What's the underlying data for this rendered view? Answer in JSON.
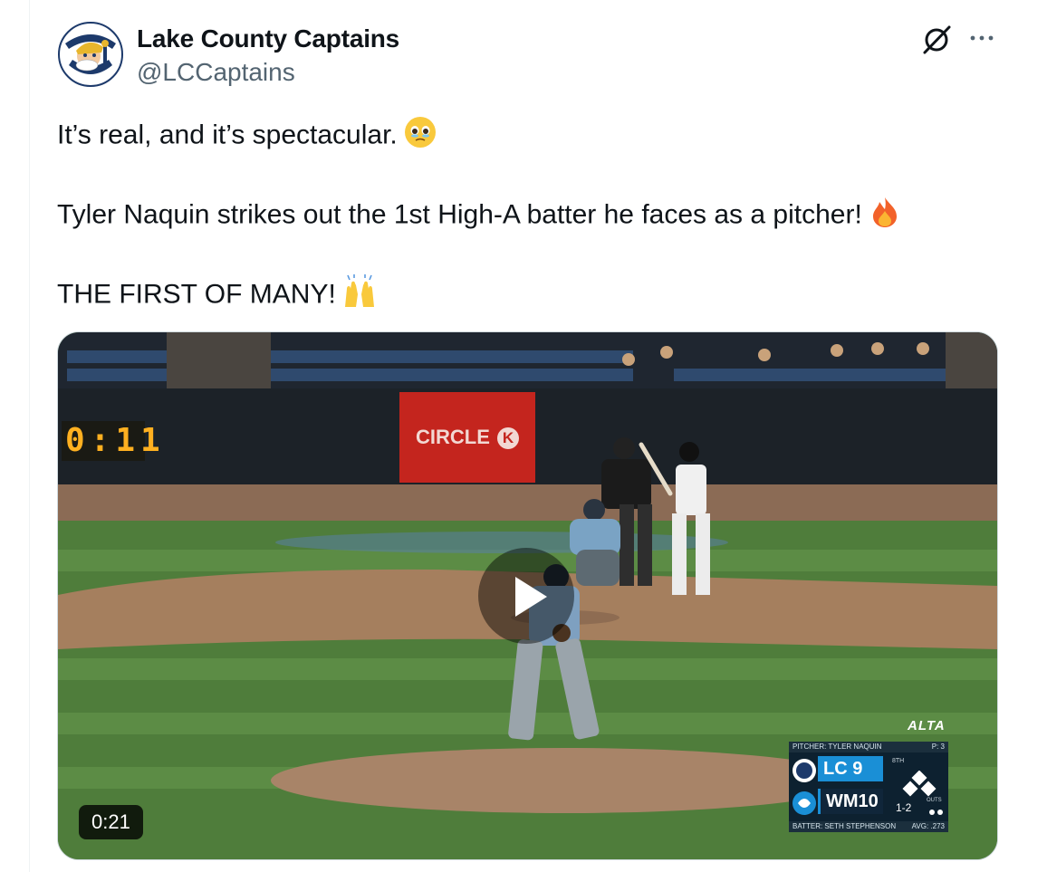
{
  "account": {
    "name": "Lake County Captains",
    "handle": "@LCCaptains",
    "avatar_text_top": "CAPTAINS",
    "avatar_text_bottom": "LAKE COUNTY"
  },
  "header_icons": [
    "grok-icon",
    "more-icon"
  ],
  "tweet": {
    "line1": "It’s real, and it’s spectacular.",
    "line1_emoji": "face-holding-back-tears",
    "line2": "Tyler Naquin strikes out the 1st High-A batter he faces as a pitcher!",
    "line2_emoji": "fire",
    "line3": "THE FIRST OF MANY!",
    "line3_emoji": "raising-hands"
  },
  "video": {
    "duration": "0:21",
    "shot_clock": "0:11",
    "sponsor": "CIRCLE",
    "sponsor_mark": "K",
    "broadcast_logo": "ALTA",
    "scorebug": {
      "pitcher_label": "PITCHER:",
      "pitcher_name": "TYLER NAQUIN",
      "pitch_count": "P: 3",
      "team1": "LC",
      "score1": "9",
      "team2": "WM",
      "score2": "10",
      "inning": "8TH",
      "count": "1-2",
      "outs_label": "OUTS",
      "batter_label": "BATTER:",
      "batter_name": "SETH STEPHENSON",
      "avg": "AVG: .273"
    }
  },
  "colors": {
    "text": "#0f1419",
    "secondary": "#536471",
    "border": "#cfd9de",
    "accent": "#1a8fd6"
  }
}
